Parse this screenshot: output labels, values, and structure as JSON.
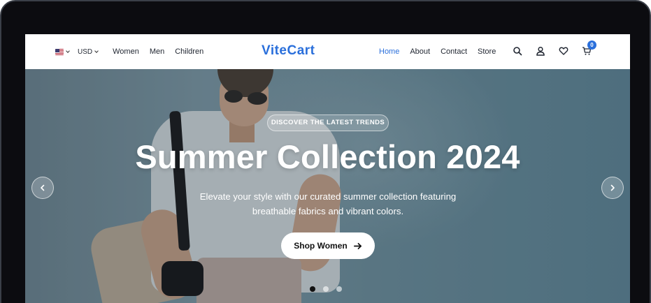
{
  "header": {
    "language_code": "US",
    "currency": "USD",
    "nav_left": [
      "Women",
      "Men",
      "Children"
    ],
    "brand": "ViteCart",
    "nav_right": [
      {
        "label": "Home",
        "active": true
      },
      {
        "label": "About",
        "active": false
      },
      {
        "label": "Contact",
        "active": false
      },
      {
        "label": "Store",
        "active": false
      }
    ],
    "icons": [
      "search-icon",
      "user-icon",
      "heart-icon",
      "cart-icon"
    ],
    "cart_count": "0"
  },
  "hero": {
    "eyebrow": "DISCOVER THE LATEST TRENDS",
    "headline": "Summer Collection 2024",
    "subtext": "Elevate your style with our curated summer collection featuring breathable fabrics and vibrant colors.",
    "cta_label": "Shop Women",
    "slides_total": 3,
    "active_slide": 1
  },
  "colors": {
    "accent": "#2a6fdb",
    "text": "#1f2530"
  }
}
